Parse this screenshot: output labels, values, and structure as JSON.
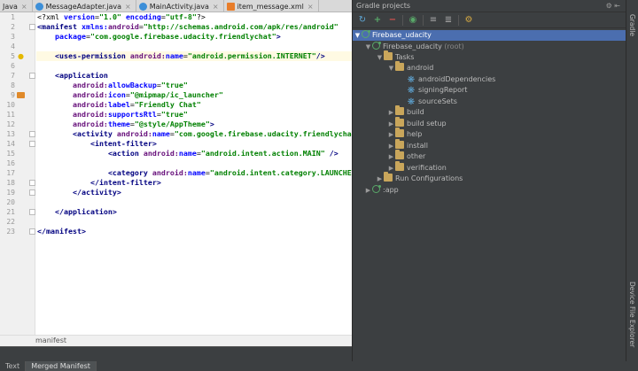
{
  "editor_tabs": [
    {
      "label": "Java",
      "icon": "c-icon",
      "close": "×"
    },
    {
      "label": "MessageAdapter.java",
      "icon": "c-icon",
      "close": "×"
    },
    {
      "label": "MainActivity.java",
      "icon": "c-icon",
      "close": "×"
    },
    {
      "label": "item_message.xml",
      "icon": "xml-icon",
      "close": "×"
    }
  ],
  "line_numbers": [
    "1",
    "2",
    "3",
    "4",
    "5",
    "6",
    "7",
    "8",
    "9",
    "10",
    "11",
    "12",
    "13",
    "14",
    "15",
    "16",
    "17",
    "18",
    "19",
    "20",
    "21",
    "22",
    "23"
  ],
  "code": {
    "l1": {
      "a": "<?xml ",
      "b": "version",
      "c": "=",
      "d": "\"1.0\"",
      "e": " ",
      "f": "encoding",
      "g": "=",
      "h": "\"utf-8\"",
      "i": "?>"
    },
    "l2": {
      "a": "<manifest ",
      "b": "xmlns:",
      "c": "android",
      "d": "=",
      "e": "\"http://schemas.android.com/apk/res/android\""
    },
    "l3": {
      "indent": "    ",
      "b": "package",
      "d": "=",
      "e": "\"com.google.firebase.udacity.friendlychat\"",
      "f": ">"
    },
    "l5": {
      "indent": "    ",
      "a": "<uses-permission ",
      "b": "android:",
      "c": "name",
      "d": "=",
      "e": "\"android.permission.INTERNET\"",
      "f": "/>"
    },
    "l7": {
      "indent": "    ",
      "a": "<application"
    },
    "l8": {
      "indent": "        ",
      "b": "android:",
      "c": "allowBackup",
      "d": "=",
      "e": "\"true\""
    },
    "l9": {
      "indent": "        ",
      "b": "android:",
      "c": "icon",
      "d": "=",
      "e": "\"@mipmap/ic_launcher\""
    },
    "l10": {
      "indent": "        ",
      "b": "android:",
      "c": "label",
      "d": "=",
      "e": "\"Friendly Chat\""
    },
    "l11": {
      "indent": "        ",
      "b": "android:",
      "c": "supportsRtl",
      "d": "=",
      "e": "\"true\""
    },
    "l12": {
      "indent": "        ",
      "b": "android:",
      "c": "theme",
      "d": "=",
      "e": "\"@style/AppTheme\"",
      "f": ">"
    },
    "l13": {
      "indent": "        ",
      "a": "<activity ",
      "b": "android:",
      "c": "name",
      "d": "=",
      "e": "\"com.google.firebase.udacity.friendlychat"
    },
    "l14": {
      "indent": "            ",
      "a": "<intent-filter>"
    },
    "l15": {
      "indent": "                ",
      "a": "<action ",
      "b": "android:",
      "c": "name",
      "d": "=",
      "e": "\"android.intent.action.MAIN\"",
      "f": " />"
    },
    "l17": {
      "indent": "                ",
      "a": "<category ",
      "b": "android:",
      "c": "name",
      "d": "=",
      "e": "\"android.intent.category.LAUNCHE"
    },
    "l18": {
      "indent": "            ",
      "a": "</intent-filter>"
    },
    "l19": {
      "indent": "        ",
      "a": "</activity>"
    },
    "l21": {
      "indent": "    ",
      "a": "</application>"
    },
    "l23": {
      "a": "</manifest>"
    }
  },
  "breadcrumb": "manifest",
  "bottom_tabs": [
    {
      "label": "Text",
      "active": false
    },
    {
      "label": "Merged Manifest",
      "active": true
    }
  ],
  "gradle": {
    "title": "Gradle projects",
    "title_controls": "⚙ ⇤",
    "toolbar_icons": [
      "refresh-icon",
      "add-icon",
      "remove-icon",
      "execute-task-icon",
      "expand-all-icon",
      "collapse-all-icon",
      "offline-mode-icon"
    ],
    "tree": [
      {
        "label": "Firebase_udacity",
        "extra": "",
        "depth": 0,
        "arrow": "▼",
        "icon": "project",
        "selected": true
      },
      {
        "label": "Firebase_udacity",
        "extra": " (root)",
        "depth": 1,
        "arrow": "▼",
        "icon": "project",
        "selected": false
      },
      {
        "label": "Tasks",
        "extra": "",
        "depth": 2,
        "arrow": "▼",
        "icon": "folder",
        "selected": false
      },
      {
        "label": "android",
        "extra": "",
        "depth": 3,
        "arrow": "▼",
        "icon": "folder",
        "selected": false
      },
      {
        "label": "androidDependencies",
        "extra": "",
        "depth": 4,
        "arrow": "",
        "icon": "gear",
        "selected": false
      },
      {
        "label": "signingReport",
        "extra": "",
        "depth": 4,
        "arrow": "",
        "icon": "gear",
        "selected": false
      },
      {
        "label": "sourceSets",
        "extra": "",
        "depth": 4,
        "arrow": "",
        "icon": "gear",
        "selected": false
      },
      {
        "label": "build",
        "extra": "",
        "depth": 3,
        "arrow": "▶",
        "icon": "folder",
        "selected": false
      },
      {
        "label": "build setup",
        "extra": "",
        "depth": 3,
        "arrow": "▶",
        "icon": "folder",
        "selected": false
      },
      {
        "label": "help",
        "extra": "",
        "depth": 3,
        "arrow": "▶",
        "icon": "folder",
        "selected": false
      },
      {
        "label": "install",
        "extra": "",
        "depth": 3,
        "arrow": "▶",
        "icon": "folder",
        "selected": false
      },
      {
        "label": "other",
        "extra": "",
        "depth": 3,
        "arrow": "▶",
        "icon": "folder",
        "selected": false
      },
      {
        "label": "verification",
        "extra": "",
        "depth": 3,
        "arrow": "▶",
        "icon": "folder",
        "selected": false
      },
      {
        "label": "Run Configurations",
        "extra": "",
        "depth": 2,
        "arrow": "▶",
        "icon": "folder",
        "selected": false
      },
      {
        "label": ":app",
        "extra": "",
        "depth": 1,
        "arrow": "▶",
        "icon": "project",
        "selected": false
      }
    ]
  },
  "right_stripe": {
    "top_label": "Gradle",
    "bottom_label": "Device File Explorer"
  }
}
